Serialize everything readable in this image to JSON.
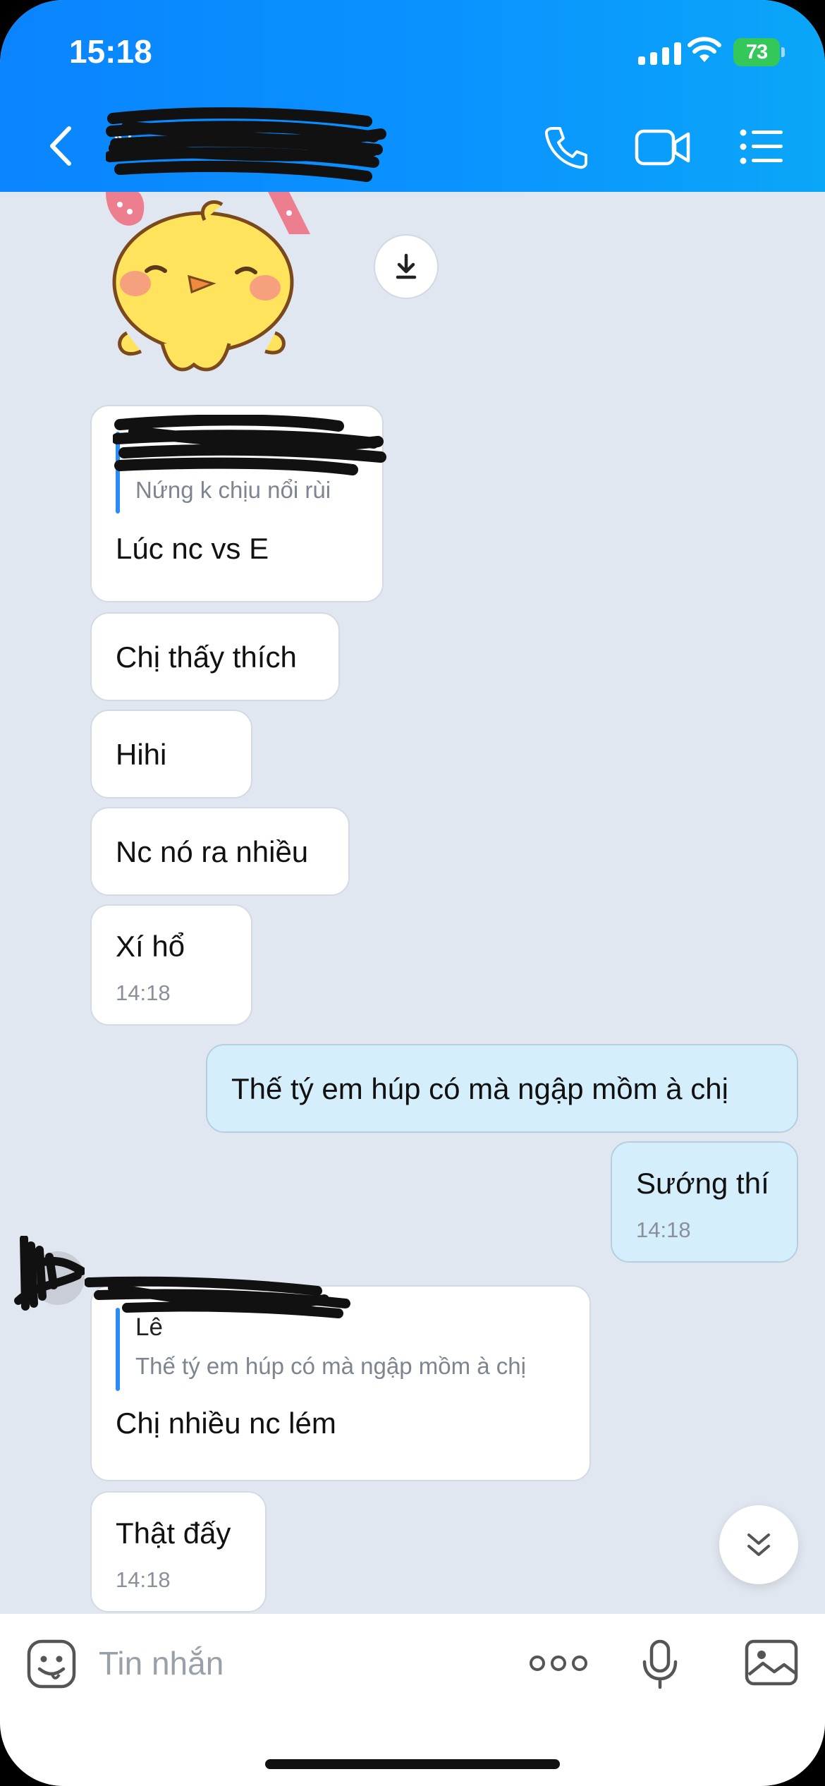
{
  "status_bar": {
    "time": "15:18",
    "battery": "73"
  },
  "header": {
    "contact_name": "Ng"
  },
  "messages": {
    "m1": {
      "quote_author": "",
      "quote_text": "Nứng k chịu nổi rùi",
      "text": "Lúc nc vs E"
    },
    "m2": {
      "text": "Chị thấy thích"
    },
    "m3": {
      "text": "Hihi"
    },
    "m4": {
      "text": "Nc nó ra nhiều"
    },
    "m5": {
      "text": "Xí hổ",
      "time": "14:18"
    },
    "m6": {
      "text": "Thế tý em húp có mà ngập mồm à chị"
    },
    "m7": {
      "text": "Sướng thí",
      "time": "14:18"
    },
    "m8": {
      "quote_author": "Lê",
      "quote_text": "Thế tý em húp có mà ngập mồm à chị",
      "text": "Chị nhiều nc lém"
    },
    "m9": {
      "text": "Thật đấy",
      "time": "14:18"
    }
  },
  "input": {
    "placeholder": "Tin nhắn"
  },
  "icons": {
    "back": "chevron-left-icon",
    "call": "phone-icon",
    "video": "video-camera-icon",
    "menu": "list-icon",
    "download": "download-icon",
    "scroll": "double-chevron-down-icon",
    "emoji": "emoji-icon",
    "more": "more-dots-icon",
    "mic": "microphone-icon",
    "image": "image-icon"
  },
  "colors": {
    "header": "#0a93ff",
    "chat_bg": "#e1e7f0",
    "own_bubble": "#d4eefc",
    "quote_bar": "#2b8cf5",
    "battery": "#34c759"
  }
}
